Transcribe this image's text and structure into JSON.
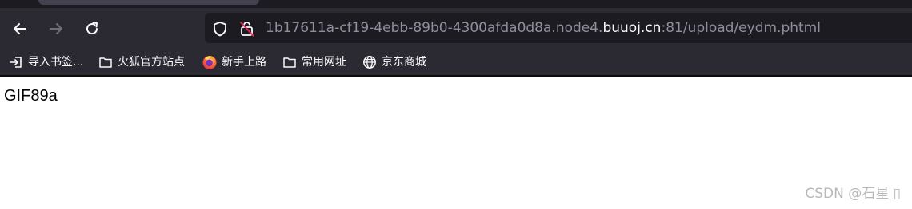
{
  "toolbar": {
    "back_icon": "arrow-left-icon",
    "forward_icon": "arrow-right-icon",
    "reload_icon": "reload-icon"
  },
  "urlbar": {
    "shield_icon": "shield-icon",
    "insecure_icon": "insecure-connection-icon",
    "url_prefix": "1b17611a-cf19-4ebb-89b0-4300afda0d8a.node4.",
    "url_domain": "buuoj.cn",
    "url_suffix": ":81/upload/eydm.phtml"
  },
  "bookmarks": {
    "items": [
      {
        "label": "导入书签...",
        "icon": "import-icon"
      },
      {
        "label": "火狐官方站点",
        "icon": "folder-icon"
      },
      {
        "label": "新手上路",
        "icon": "firefox-logo-icon"
      },
      {
        "label": "常用网址",
        "icon": "folder-icon"
      },
      {
        "label": "京东商城",
        "icon": "globe-icon"
      }
    ]
  },
  "page": {
    "content_text": "GIF89a"
  },
  "watermark": {
    "text": "CSDN @石星 ▯"
  },
  "colors": {
    "chrome_bg": "#2b2a33",
    "urlbar_bg": "#1c1b22",
    "chrome_text": "#fbfbfe",
    "url_dim_text": "#8f8f9d"
  }
}
